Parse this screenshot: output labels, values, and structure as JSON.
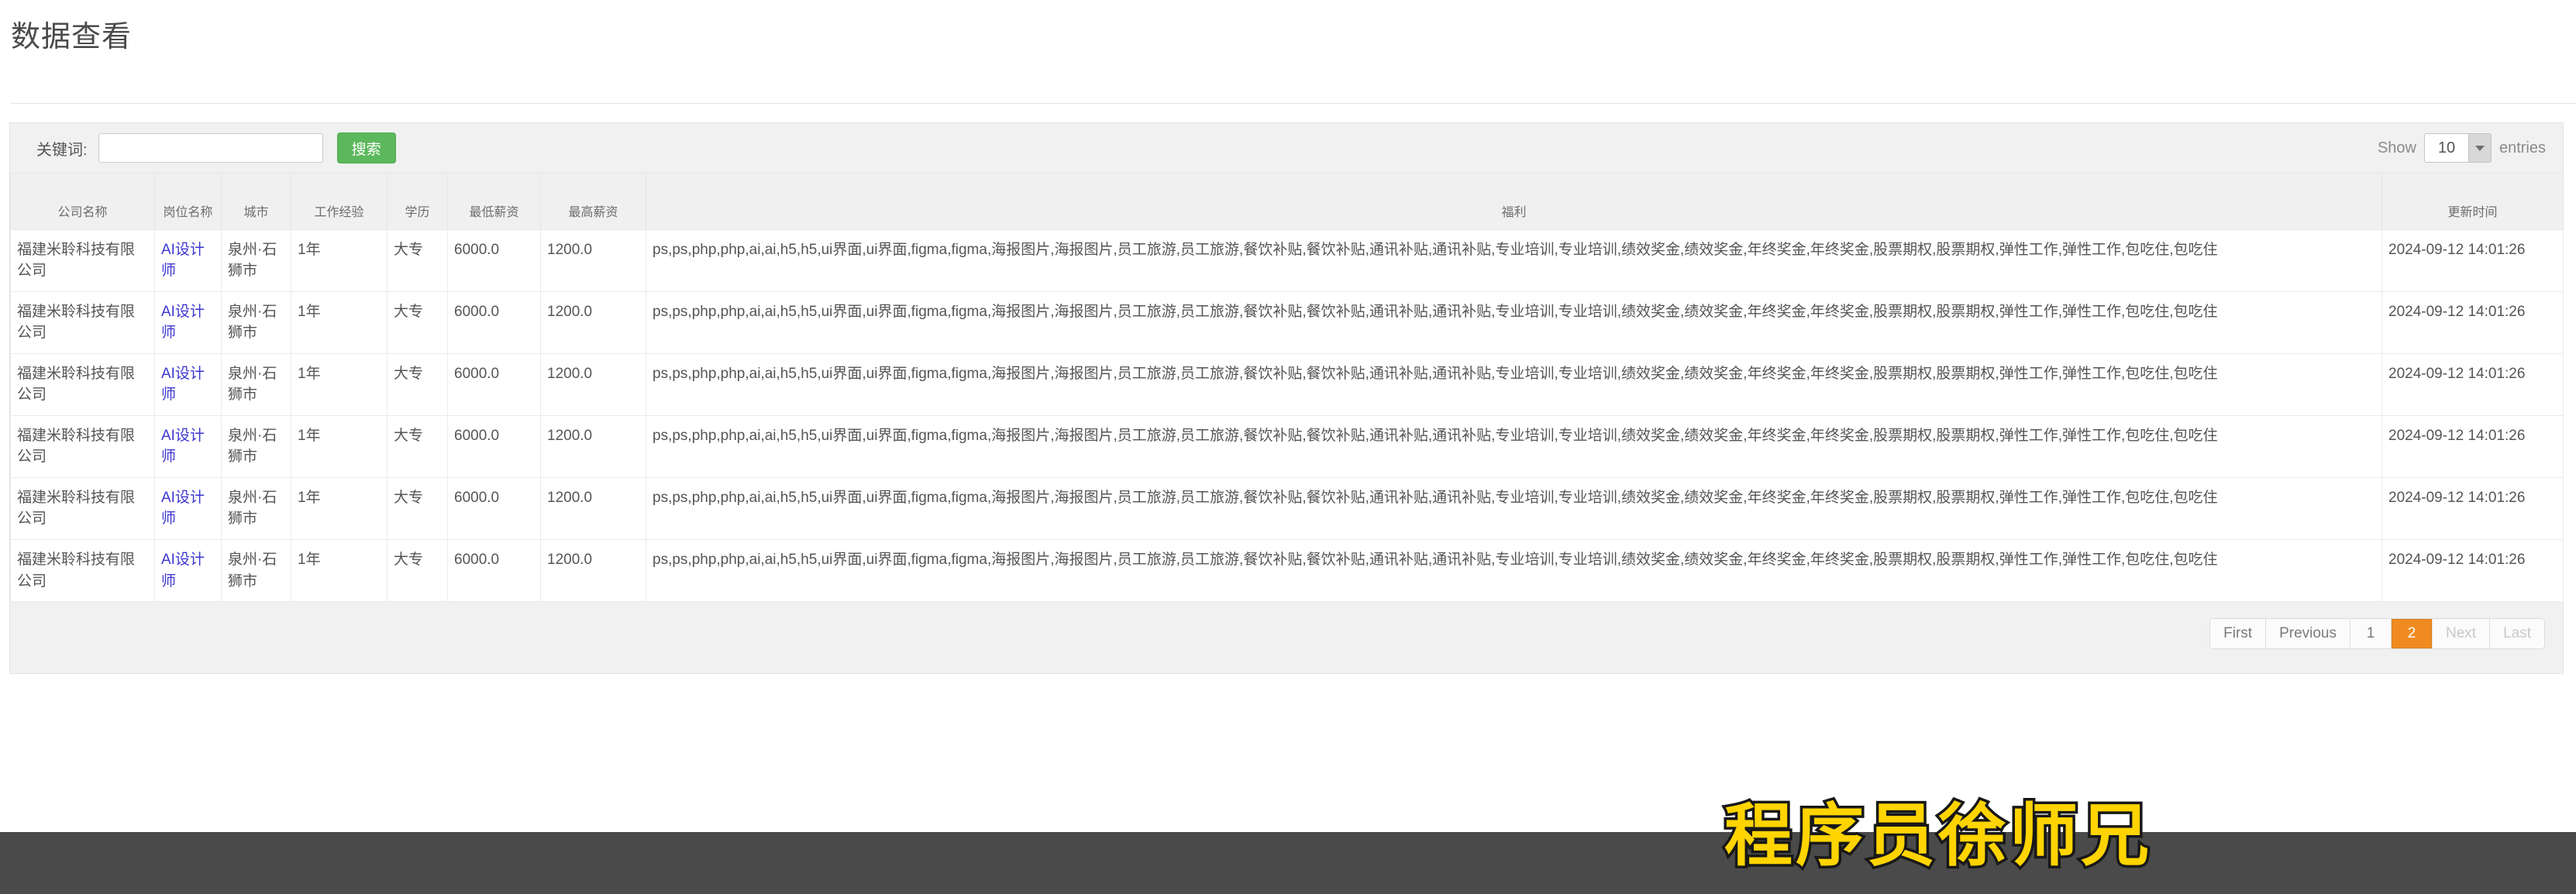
{
  "page": {
    "title": "数据查看"
  },
  "toolbar": {
    "keyword_label": "关键词:",
    "keyword_value": "",
    "keyword_placeholder": "",
    "search_button": "搜索",
    "show_prefix": "Show",
    "entries_value": "10",
    "entries_suffix": "entries",
    "search_button_color": "#5cb85c"
  },
  "table": {
    "columns": [
      "公司名称",
      "岗位名称",
      "城市",
      "工作经验",
      "学历",
      "最低薪资",
      "最高薪资",
      "福利",
      "更新时间"
    ],
    "rows": [
      {
        "company": "福建米聆科技有限公司",
        "job": "AI设计师",
        "city": "泉州·石狮市",
        "experience": "1年",
        "education": "大专",
        "salary_min": "6000.0",
        "salary_max": "1200.0",
        "welfare": "ps,ps,php,php,ai,ai,h5,h5,ui界面,ui界面,figma,figma,海报图片,海报图片,员工旅游,员工旅游,餐饮补贴,餐饮补贴,通讯补贴,通讯补贴,专业培训,专业培训,绩效奖金,绩效奖金,年终奖金,年终奖金,股票期权,股票期权,弹性工作,弹性工作,包吃住,包吃住",
        "updated": "2024-09-12 14:01:26"
      },
      {
        "company": "福建米聆科技有限公司",
        "job": "AI设计师",
        "city": "泉州·石狮市",
        "experience": "1年",
        "education": "大专",
        "salary_min": "6000.0",
        "salary_max": "1200.0",
        "welfare": "ps,ps,php,php,ai,ai,h5,h5,ui界面,ui界面,figma,figma,海报图片,海报图片,员工旅游,员工旅游,餐饮补贴,餐饮补贴,通讯补贴,通讯补贴,专业培训,专业培训,绩效奖金,绩效奖金,年终奖金,年终奖金,股票期权,股票期权,弹性工作,弹性工作,包吃住,包吃住",
        "updated": "2024-09-12 14:01:26"
      },
      {
        "company": "福建米聆科技有限公司",
        "job": "AI设计师",
        "city": "泉州·石狮市",
        "experience": "1年",
        "education": "大专",
        "salary_min": "6000.0",
        "salary_max": "1200.0",
        "welfare": "ps,ps,php,php,ai,ai,h5,h5,ui界面,ui界面,figma,figma,海报图片,海报图片,员工旅游,员工旅游,餐饮补贴,餐饮补贴,通讯补贴,通讯补贴,专业培训,专业培训,绩效奖金,绩效奖金,年终奖金,年终奖金,股票期权,股票期权,弹性工作,弹性工作,包吃住,包吃住",
        "updated": "2024-09-12 14:01:26"
      },
      {
        "company": "福建米聆科技有限公司",
        "job": "AI设计师",
        "city": "泉州·石狮市",
        "experience": "1年",
        "education": "大专",
        "salary_min": "6000.0",
        "salary_max": "1200.0",
        "welfare": "ps,ps,php,php,ai,ai,h5,h5,ui界面,ui界面,figma,figma,海报图片,海报图片,员工旅游,员工旅游,餐饮补贴,餐饮补贴,通讯补贴,通讯补贴,专业培训,专业培训,绩效奖金,绩效奖金,年终奖金,年终奖金,股票期权,股票期权,弹性工作,弹性工作,包吃住,包吃住",
        "updated": "2024-09-12 14:01:26"
      },
      {
        "company": "福建米聆科技有限公司",
        "job": "AI设计师",
        "city": "泉州·石狮市",
        "experience": "1年",
        "education": "大专",
        "salary_min": "6000.0",
        "salary_max": "1200.0",
        "welfare": "ps,ps,php,php,ai,ai,h5,h5,ui界面,ui界面,figma,figma,海报图片,海报图片,员工旅游,员工旅游,餐饮补贴,餐饮补贴,通讯补贴,通讯补贴,专业培训,专业培训,绩效奖金,绩效奖金,年终奖金,年终奖金,股票期权,股票期权,弹性工作,弹性工作,包吃住,包吃住",
        "updated": "2024-09-12 14:01:26"
      },
      {
        "company": "福建米聆科技有限公司",
        "job": "AI设计师",
        "city": "泉州·石狮市",
        "experience": "1年",
        "education": "大专",
        "salary_min": "6000.0",
        "salary_max": "1200.0",
        "welfare": "ps,ps,php,php,ai,ai,h5,h5,ui界面,ui界面,figma,figma,海报图片,海报图片,员工旅游,员工旅游,餐饮补贴,餐饮补贴,通讯补贴,通讯补贴,专业培训,专业培训,绩效奖金,绩效奖金,年终奖金,年终奖金,股票期权,股票期权,弹性工作,弹性工作,包吃住,包吃住",
        "updated": "2024-09-12 14:01:26"
      }
    ]
  },
  "pagination": {
    "first": "First",
    "previous": "Previous",
    "pages": [
      "1",
      "2"
    ],
    "active_page": "2",
    "next": "Next",
    "last": "Last",
    "active_color": "#ef8b21"
  },
  "watermark": {
    "text": "程序员徐师兄",
    "fill_color": "#ffd400",
    "stroke_color": "#181818"
  }
}
